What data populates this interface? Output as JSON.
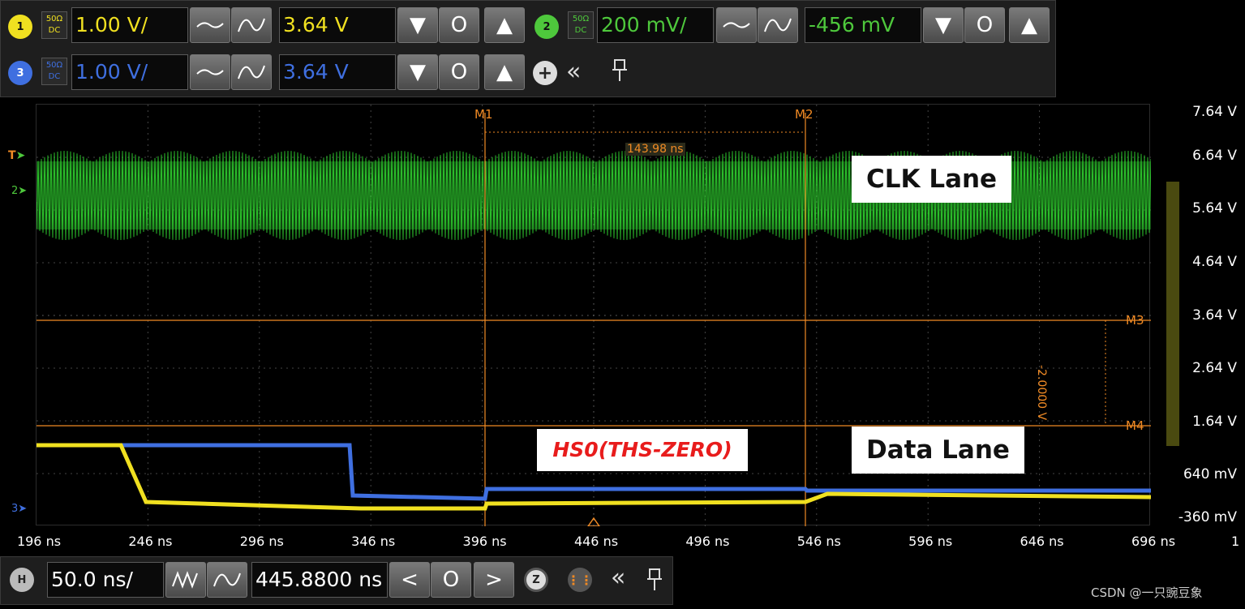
{
  "channels": {
    "ch1": {
      "number": "1",
      "coupling_top": "50Ω",
      "coupling_bottom": "DC",
      "scale": "1.00 V/",
      "offset": "3.64 V",
      "color": "#f0e020"
    },
    "ch2": {
      "number": "2",
      "coupling_top": "50Ω",
      "coupling_bottom": "DC",
      "scale": "200 mV/",
      "offset": "-456 mV",
      "color": "#4ec83c"
    },
    "ch3": {
      "number": "3",
      "coupling_top": "50Ω",
      "coupling_bottom": "DC",
      "scale": "1.00 V/",
      "offset": "3.64 V",
      "color": "#3f6fe0"
    }
  },
  "buttons": {
    "down": "▼",
    "zero": "O",
    "up": "▲",
    "add": "+",
    "collapse": "«",
    "pin": "⌐"
  },
  "icons": [
    "waveform-smooth-icon",
    "waveform-sine-icon",
    "add-channel-icon",
    "collapse-icon",
    "pin-icon",
    "zoom-icon",
    "acquire-icon"
  ],
  "trace_labels": {
    "trigger": "T",
    "ch2_ref": "2",
    "ch3_ref": "3"
  },
  "y_axis": [
    "7.64 V",
    "6.64 V",
    "5.64 V",
    "4.64 V",
    "3.64 V",
    "2.64 V",
    "1.64 V",
    "640 mV",
    "-360 mV"
  ],
  "x_axis": [
    "196 ns",
    "246 ns",
    "296 ns",
    "346 ns",
    "396 ns",
    "446 ns",
    "496 ns",
    "546 ns",
    "596 ns",
    "646 ns",
    "696 ns"
  ],
  "x_axis_right": "1",
  "markers": {
    "m1": "M1",
    "m2": "M2",
    "m3": "M3",
    "m4": "M4",
    "dt": "143.98 ns",
    "dv": "-2.0000 V"
  },
  "annotations": {
    "clk_lane": "CLK Lane",
    "data_lane": "Data Lane",
    "hs0": "HS0(THS-ZERO)"
  },
  "horizontal": {
    "label": "H",
    "scale": "50.0 ns/",
    "position": "445.8800 ns",
    "left": "<",
    "zero": "O",
    "right": ">",
    "zoom": "Z"
  },
  "watermark": "CSDN @一只豌豆象",
  "colors": {
    "marker": "#f08a24",
    "clk": "#2fcc2f",
    "data_ch1": "#f0e020",
    "data_ch3": "#3f6fe0"
  }
}
